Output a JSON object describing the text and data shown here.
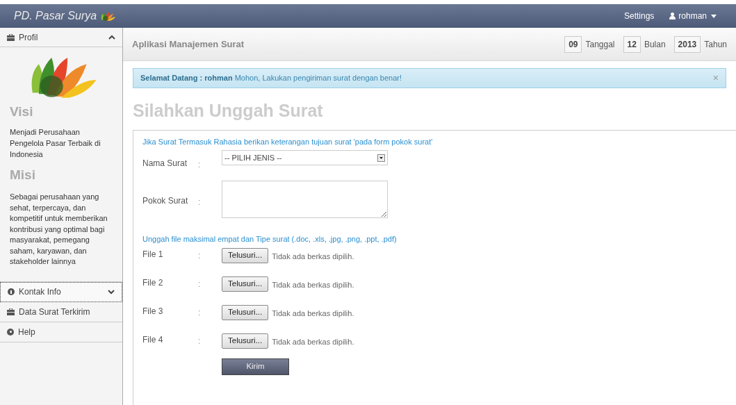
{
  "navbar": {
    "brand": "PD. Pasar Surya",
    "links": [
      "Settings"
    ],
    "user": "rohman"
  },
  "sidebar": {
    "profile": {
      "label": "Profil",
      "expanded": true,
      "visi_title": "Visi",
      "visi_text": "Menjadi Perusahaan Pengelola Pasar Terbaik di Indonesia",
      "misi_title": "Misi",
      "misi_text": "Sebagai perusahaan yang sehat, terpercaya, dan kompetitif untuk memberikan kontribusi yang optimal bagi masyarakat, pemegang saham, karyawan, dan stakeholder lainnya"
    },
    "items": [
      {
        "label": "Kontak Info",
        "kind": "info",
        "expanded": false,
        "selected": true
      },
      {
        "label": "Data Surat Terkirim",
        "kind": "briefcase",
        "selected": false
      },
      {
        "label": "Help",
        "kind": "help",
        "selected": false
      }
    ]
  },
  "header": {
    "title": "Aplikasi Manajemen Surat",
    "date": [
      {
        "value": "09",
        "suffix": "Tanggal"
      },
      {
        "value": "12",
        "suffix": "Bulan"
      },
      {
        "value": "2013",
        "suffix": "Tahun"
      }
    ]
  },
  "alert": {
    "text": "**Selamat Datang : rohman** Mohon, Lakukan pengiriman surat dengan benar!",
    "close": "×"
  },
  "page_title": "Silahkan Unggah Surat",
  "form": {
    "note": "Jika Surat Termasuk Rahasia berikan keterangan tujuan surat 'pada form pokok surat'",
    "nama_surat": {
      "label": "Nama Surat",
      "value": "-- PILIH JENIS --"
    },
    "pokok_surat": {
      "label": "Pokok Surat"
    },
    "upload_note": "Unggah file maksimal empat dan Tipe surat (.doc, .xls, .jpg, .png, .ppt, .pdf)",
    "files": [
      {
        "label": "File 1",
        "button": "Telusuri...",
        "status": "Tidak ada berkas dipilih."
      },
      {
        "label": "File 2",
        "button": "Telusuri...",
        "status": "Tidak ada berkas dipilih."
      },
      {
        "label": "File 3",
        "button": "Telusuri...",
        "status": "Tidak ada berkas dipilih."
      },
      {
        "label": "File 4",
        "button": "Telusuri...",
        "status": "Tidak ada berkas dipilih."
      }
    ],
    "colon": ":",
    "submit": "Kirim"
  }
}
